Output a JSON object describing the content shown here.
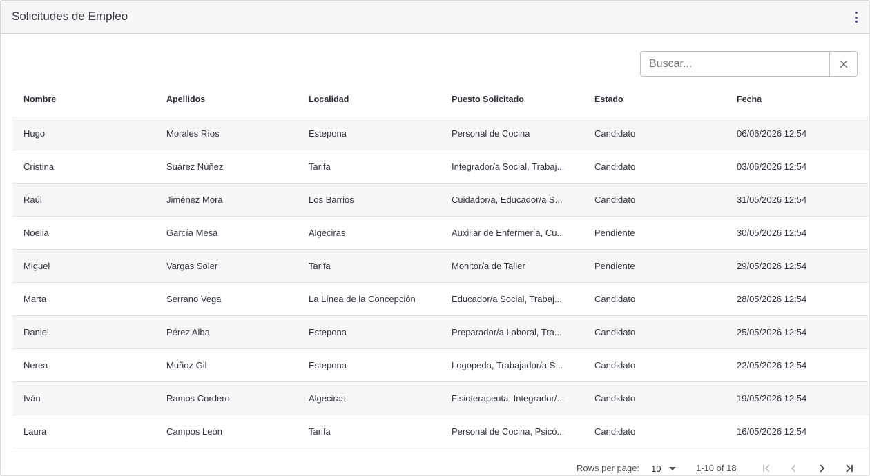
{
  "header": {
    "title": "Solicitudes de Empleo",
    "menu_icon": "more-vertical-icon"
  },
  "search": {
    "placeholder": "Buscar...",
    "value": "",
    "clear_icon": "close-icon"
  },
  "table": {
    "columns": [
      "Nombre",
      "Apellidos",
      "Localidad",
      "Puesto Solicitado",
      "Estado",
      "Fecha"
    ],
    "rows": [
      [
        "Hugo",
        "Morales Ríos",
        "Estepona",
        "Personal de Cocina",
        "Candidato",
        "06/06/2026 12:54"
      ],
      [
        "Cristina",
        "Suárez Núñez",
        "Tarifa",
        "Integrador/a Social, Trabaj...",
        "Candidato",
        "03/06/2026 12:54"
      ],
      [
        "Raúl",
        "Jiménez Mora",
        "Los Barrios",
        "Cuidador/a, Educador/a S...",
        "Candidato",
        "31/05/2026 12:54"
      ],
      [
        "Noelia",
        "García Mesa",
        "Algeciras",
        "Auxiliar de Enfermería, Cu...",
        "Pendiente",
        "30/05/2026 12:54"
      ],
      [
        "Miguel",
        "Vargas Soler",
        "Tarifa",
        "Monitor/a de Taller",
        "Pendiente",
        "29/05/2026 12:54"
      ],
      [
        "Marta",
        "Serrano Vega",
        "La Línea de la Concepción",
        "Educador/a Social, Trabaj...",
        "Candidato",
        "28/05/2026 12:54"
      ],
      [
        "Daniel",
        "Pérez Alba",
        "Estepona",
        "Preparador/a Laboral, Tra...",
        "Candidato",
        "25/05/2026 12:54"
      ],
      [
        "Nerea",
        "Muñoz Gil",
        "Estepona",
        "Logopeda, Trabajador/a S...",
        "Candidato",
        "22/05/2026 12:54"
      ],
      [
        "Iván",
        "Ramos Cordero",
        "Algeciras",
        "Fisioterapeuta, Integrador/...",
        "Candidato",
        "19/05/2026 12:54"
      ],
      [
        "Laura",
        "Campos León",
        "Tarifa",
        "Personal de Cocina, Psicó...",
        "Candidato",
        "16/05/2026 12:54"
      ]
    ]
  },
  "pagination": {
    "rows_per_page_label": "Rows per page:",
    "rows_per_page_value": "10",
    "range_text": "1-10 of 18",
    "icons": [
      "first-page-icon",
      "previous-page-icon",
      "next-page-icon",
      "last-page-icon"
    ]
  },
  "colors": {
    "accent": "#5a3dc4",
    "header_bg": "#f7f7f7",
    "row_alt_bg": "#f7f7f7"
  }
}
